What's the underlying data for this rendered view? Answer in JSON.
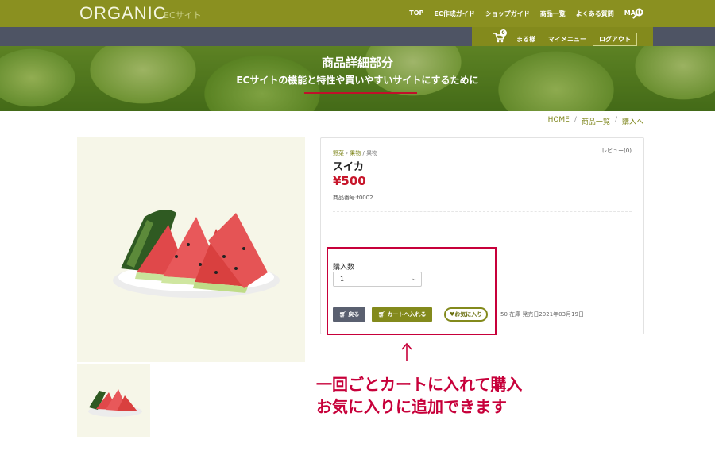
{
  "header": {
    "logo": "ORGANIC",
    "logo_sub": "ECサイト",
    "nav": [
      "TOP",
      "EC作成ガイド",
      "ショップガイド",
      "商品一覧",
      "よくある質問",
      "MAIL"
    ],
    "cart_count": "0",
    "user_name": "まる様",
    "my_menu": "マイメニュー",
    "logout": "ログアウト"
  },
  "hero": {
    "title": "商品詳細部分",
    "subtitle": "ECサイトの機能と特性や買いやすいサイトにするために"
  },
  "breadcrumb": [
    "HOME",
    "商品一覧",
    "購入へ"
  ],
  "product": {
    "category_links": [
      "野菜",
      "果物"
    ],
    "category_current": "果物",
    "review": "レビュー(0)",
    "name": "スイカ",
    "price": "¥500",
    "code": "商品番号:f0002",
    "qty_label": "購入数",
    "qty_value": "1",
    "back_button": "戻る",
    "cart_button": "カートへ入れる",
    "fav_button": "♥お気に入り",
    "stock": "50 在庫  発売日2021年03月19日"
  },
  "annotation": {
    "line1": "一回ごとカートに入れて購入",
    "line2": "お気に入りに追加できます"
  },
  "colors": {
    "brand_green": "#838a1c",
    "dark_bar": "#4e5464",
    "price_red": "#c7162b",
    "annotation_red": "#c7003a"
  },
  "icons": [
    "search-icon",
    "cart-icon",
    "arrow-up-icon",
    "watermelon-image"
  ]
}
